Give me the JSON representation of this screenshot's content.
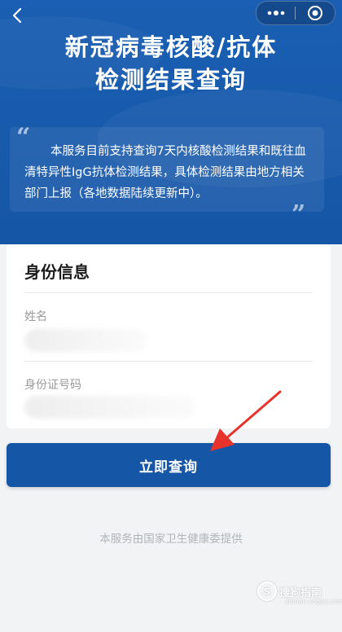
{
  "header": {
    "back_icon": "chevron-left-icon",
    "menu_icon": "more-dots-icon",
    "close_icon": "target-circle-icon",
    "title_line1": "新冠病毒核酸/抗体",
    "title_line2": "检测结果查询"
  },
  "notice": {
    "open_quote": "“",
    "close_quote": "”",
    "text": "本服务目前支持查询7天内核酸检测结果和既往血清特异性IgG抗体检测结果，具体检测结果由地方相关部门上报（各地数据陆续更新中）。"
  },
  "form": {
    "section_title": "身份信息",
    "name_label": "姓名",
    "id_label": "身份证号码"
  },
  "submit_label": "立即查询",
  "footer_text": "本服务由国家卫生健康委提供",
  "annotation": {
    "arrow_color": "#e8332d"
  },
  "watermark": {
    "logo_char": "S",
    "text": "搜狗指南",
    "url": "zhinan.sogou.com"
  },
  "colors": {
    "primary": "#1656a6",
    "page_bg": "#f2f3f5"
  }
}
